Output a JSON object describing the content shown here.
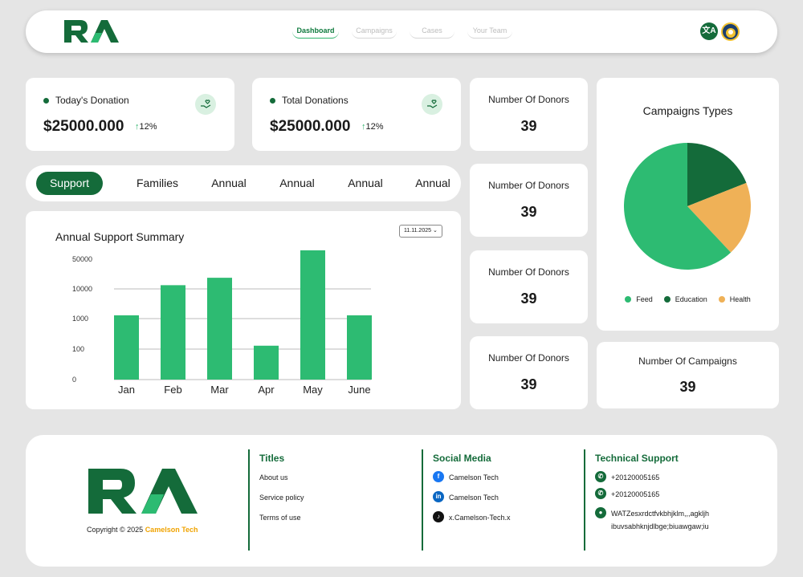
{
  "header": {
    "nav": [
      "Dashboard",
      "Campaigns",
      "Cases",
      "Your Team"
    ],
    "lang_glyph": "文A"
  },
  "stats": {
    "today": {
      "label": "Today's Donation",
      "value": "$25000.000",
      "trend": "12%"
    },
    "total": {
      "label": "Total Donations",
      "value": "$25000.000",
      "trend": "12%"
    }
  },
  "donors": [
    {
      "label": "Number Of Donors",
      "value": "39"
    },
    {
      "label": "Number Of Donors",
      "value": "39"
    },
    {
      "label": "Number Of Donors",
      "value": "39"
    },
    {
      "label": "Number Of Donors",
      "value": "39"
    }
  ],
  "campaigns_count": {
    "label": "Number Of Campaigns",
    "value": "39"
  },
  "tabs": [
    "Support",
    "Families",
    "Annual",
    "Annual",
    "Annual",
    "Annual"
  ],
  "chart_data": {
    "type": "bar",
    "title": "Annual Support Summary",
    "date": "11.11.2025",
    "y_ticks": [
      "50000",
      "10000",
      "1000",
      "100",
      "0"
    ],
    "categories": [
      "Jan",
      "Feb",
      "Mar",
      "Apr",
      "May",
      "June"
    ],
    "values": [
      2000,
      15000,
      25000,
      200,
      65000,
      2000
    ],
    "color": "#2dbb72",
    "grid": true
  },
  "pie": {
    "title": "Campaigns Types",
    "chart_data": {
      "type": "pie",
      "labels": [
        "Feed",
        "Education",
        "Health"
      ],
      "values": [
        62,
        19,
        19
      ],
      "colors": [
        "#2dbb72",
        "#146b3a",
        "#efb157"
      ]
    }
  },
  "footer": {
    "copyright": "Copyright © 2025",
    "brand": "Camelson Tech",
    "titles": {
      "heading": "Titles",
      "links": [
        "About us",
        "Service policy",
        "Terms of use"
      ]
    },
    "social": {
      "heading": "Social Media",
      "links": [
        "Camelson Tech",
        "Camelson Tech",
        "x.Camelson-Tech.x"
      ]
    },
    "support": {
      "heading": "Technical Support",
      "phones": [
        "+20120005165",
        "+20120005165"
      ],
      "address": "WATZesxrdctfvkbhjklm,,,agkljh ibuvsabhknjdlbge;biuawgaw;iu"
    }
  }
}
